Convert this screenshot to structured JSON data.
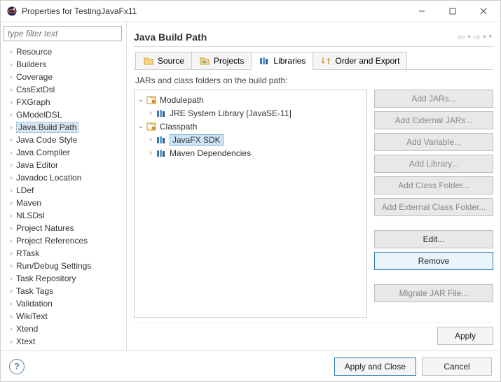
{
  "titlebar": {
    "title": "Properties for TestingJavaFx11"
  },
  "filter": {
    "placeholder": "type filter text"
  },
  "left_tree": [
    "Resource",
    "Builders",
    "Coverage",
    "CssExtDsl",
    "FXGraph",
    "GModelDSL",
    "Java Build Path",
    "Java Code Style",
    "Java Compiler",
    "Java Editor",
    "Javadoc Location",
    "LDef",
    "Maven",
    "NLSDsl",
    "Project Natures",
    "Project References",
    "RTask",
    "Run/Debug Settings",
    "Task Repository",
    "Task Tags",
    "Validation",
    "WikiText",
    "Xtend",
    "Xtext"
  ],
  "left_selected": "Java Build Path",
  "header": {
    "title": "Java Build Path"
  },
  "tabs": [
    {
      "icon": "source",
      "label": "Source"
    },
    {
      "icon": "projects",
      "label": "Projects"
    },
    {
      "icon": "libraries",
      "label": "Libraries"
    },
    {
      "icon": "order",
      "label": "Order and Export"
    }
  ],
  "active_tab": 2,
  "subtitle": "JARs and class folders on the build path:",
  "lib_tree": {
    "modulepath": {
      "label": "Modulepath",
      "children": [
        {
          "label": "JRE System Library [JavaSE-11]",
          "icon": "lib"
        }
      ]
    },
    "classpath": {
      "label": "Classpath",
      "children": [
        {
          "label": "JavaFX SDK",
          "icon": "lib",
          "selected": true
        },
        {
          "label": "Maven Dependencies",
          "icon": "lib"
        }
      ]
    }
  },
  "buttons": {
    "add_jars": "Add JARs...",
    "add_ext_jars": "Add External JARs...",
    "add_variable": "Add Variable...",
    "add_library": "Add Library...",
    "add_class_folder": "Add Class Folder...",
    "add_ext_class_folder": "Add External Class Folder...",
    "edit": "Edit...",
    "remove": "Remove",
    "migrate": "Migrate JAR File...",
    "apply": "Apply",
    "apply_close": "Apply and Close",
    "cancel": "Cancel"
  }
}
